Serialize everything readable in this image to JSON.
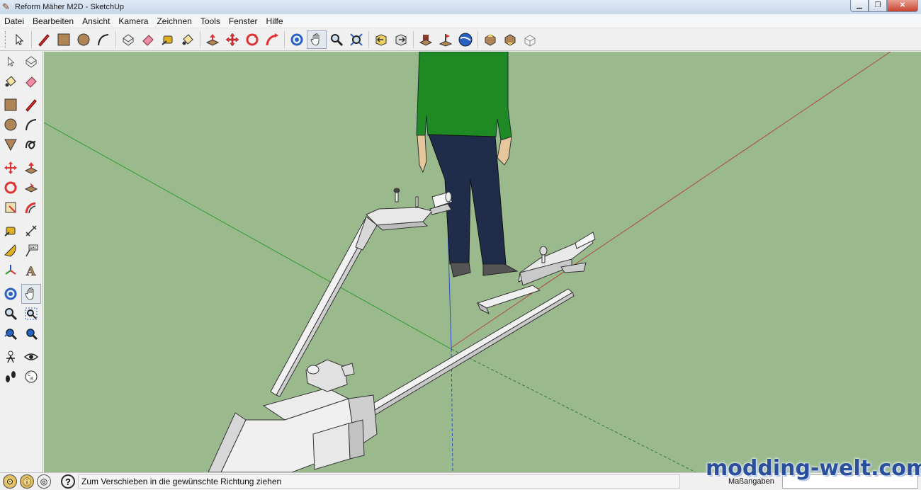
{
  "window": {
    "title": "Reform Mäher M2D - SketchUp"
  },
  "menu": [
    "Datei",
    "Bearbeiten",
    "Ansicht",
    "Kamera",
    "Zeichnen",
    "Tools",
    "Fenster",
    "Hilfe"
  ],
  "top_toolbar": [
    {
      "name": "select-icon"
    },
    {
      "sep": true
    },
    {
      "name": "pencil-icon"
    },
    {
      "name": "rectangle-icon"
    },
    {
      "name": "circle-icon"
    },
    {
      "name": "arc-icon"
    },
    {
      "sep": true
    },
    {
      "name": "make-component-icon"
    },
    {
      "name": "eraser-icon"
    },
    {
      "name": "tape-measure-icon"
    },
    {
      "name": "paint-bucket-icon"
    },
    {
      "sep": true
    },
    {
      "name": "push-pull-icon"
    },
    {
      "name": "move-icon"
    },
    {
      "name": "rotate-icon"
    },
    {
      "name": "follow-me-icon"
    },
    {
      "sep": true
    },
    {
      "name": "orbit-icon"
    },
    {
      "name": "pan-icon",
      "active": true
    },
    {
      "name": "zoom-icon"
    },
    {
      "name": "zoom-extents-icon"
    },
    {
      "sep": true
    },
    {
      "name": "previous-view-icon"
    },
    {
      "name": "next-view-icon"
    },
    {
      "sep": true
    },
    {
      "name": "warehouse-icon"
    },
    {
      "name": "add-location-icon"
    },
    {
      "name": "google-earth-icon"
    },
    {
      "sep": true
    },
    {
      "name": "share-model-icon"
    },
    {
      "name": "get-models-icon"
    },
    {
      "name": "components-icon"
    }
  ],
  "status": {
    "text": "Zum Verschieben in die gewünschte Richtung ziehen",
    "measure_label": "Maßangaben",
    "measure_value": ""
  },
  "watermark": "modding-welt.com",
  "colors": {
    "viewport_bg": "#9aba8e",
    "axis_red": "#b0463a",
    "axis_green": "#2e9a2e",
    "axis_blue": "#2b4fc9",
    "shirt": "#1f8a23",
    "jeans": "#1f2c4a"
  }
}
